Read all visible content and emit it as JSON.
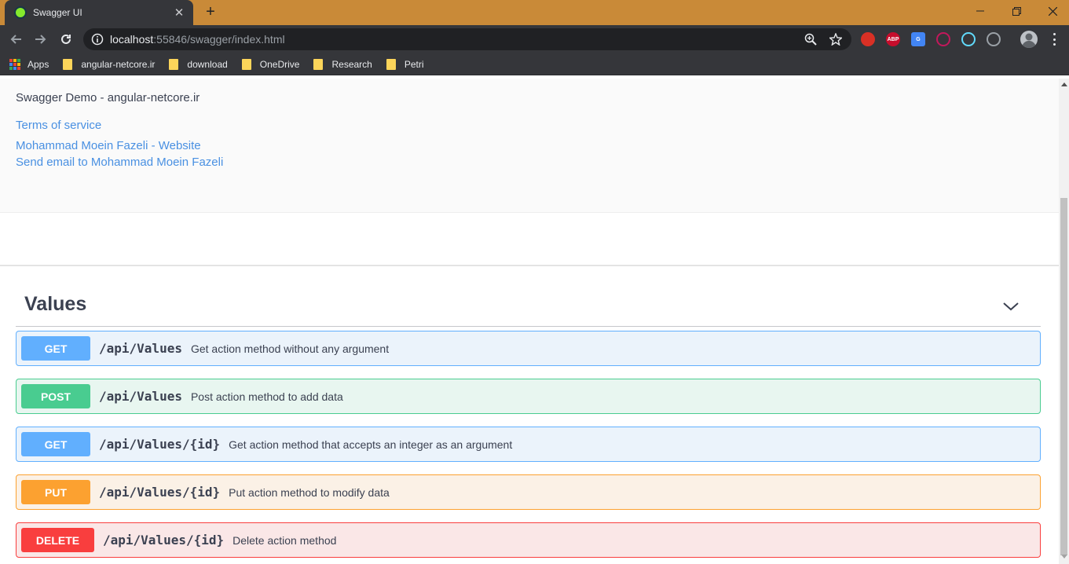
{
  "browser": {
    "tab_title": "Swagger UI",
    "tab_close": "✕",
    "new_tab": "+",
    "url_host": "localhost",
    "url_rest": ":55846/swagger/index.html",
    "bookmarks": [
      {
        "label": "Apps",
        "icon": "apps-grid-icon"
      },
      {
        "label": "angular-netcore.ir",
        "icon": "folder-icon"
      },
      {
        "label": "download",
        "icon": "folder-icon"
      },
      {
        "label": "OneDrive",
        "icon": "folder-icon"
      },
      {
        "label": "Research",
        "icon": "folder-icon"
      },
      {
        "label": "Petri",
        "icon": "folder-icon"
      }
    ],
    "extensions": [
      {
        "name": "stop-hand-extension-icon",
        "text": "",
        "color": "#d93025"
      },
      {
        "name": "adblock-plus-extension-icon",
        "text": "ABP",
        "color": "#c70d2c"
      },
      {
        "name": "google-translate-extension-icon",
        "text": "G",
        "color": "#4285f4"
      },
      {
        "name": "pen-extension-icon",
        "text": "",
        "color": "#c2185b"
      },
      {
        "name": "react-devtools-extension-icon",
        "text": "",
        "color": "#61dafb"
      },
      {
        "name": "plane-extension-icon",
        "text": "",
        "color": "#9aa0a6"
      }
    ]
  },
  "info": {
    "description": "Swagger Demo - angular-netcore.ir",
    "terms": "Terms of service",
    "contact_website": "Mohammad Moein Fazeli - Website",
    "contact_email": "Send email to Mohammad Moein Fazeli"
  },
  "tag": {
    "name": "Values"
  },
  "operations": [
    {
      "method": "GET",
      "path": "/api/Values",
      "summary": "Get action method without any argument"
    },
    {
      "method": "POST",
      "path": "/api/Values",
      "summary": "Post action method to add data"
    },
    {
      "method": "GET",
      "path": "/api/Values/{id}",
      "summary": "Get action method that accepts an integer as an argument"
    },
    {
      "method": "PUT",
      "path": "/api/Values/{id}",
      "summary": "Put action method to modify data"
    },
    {
      "method": "DELETE",
      "path": "/api/Values/{id}",
      "summary": "Delete action method"
    }
  ],
  "colors": {
    "GET": {
      "badge": "#61affe",
      "bg": "#ebf3fb",
      "border": "#61affe"
    },
    "POST": {
      "badge": "#49cc90",
      "bg": "#e8f6f0",
      "border": "#49cc90"
    },
    "PUT": {
      "badge": "#fca130",
      "bg": "#fbf1e6",
      "border": "#fca130"
    },
    "DELETE": {
      "badge": "#f93e3e",
      "bg": "#fae7e7",
      "border": "#f93e3e"
    }
  }
}
